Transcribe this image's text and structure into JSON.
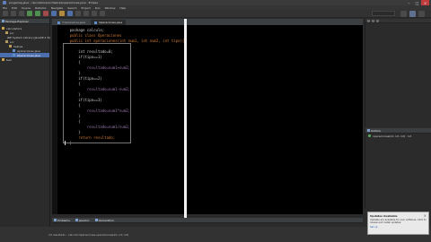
{
  "window": {
    "title": "progamey.java - calculadora/src/hebras/operaciones.java - Eclipse",
    "buttons": {
      "minimize": "–",
      "maximize": "□",
      "close": "✕"
    }
  },
  "menu": [
    "File",
    "Edit",
    "Source",
    "Refactor",
    "Navigate",
    "Search",
    "Project",
    "Run",
    "Window",
    "Help"
  ],
  "left_panel": {
    "tab_label": "Package Explorer",
    "items": [
      {
        "label": "calculadora",
        "icon": "project-icon"
      },
      {
        "label": "src",
        "icon": "package-folder-icon"
      },
      {
        "label": "JRE System Library [JavaSE-1.8]",
        "icon": "library-icon"
      },
      {
        "label": "src",
        "icon": "package-folder-icon"
      },
      {
        "label": "hebras",
        "icon": "package-icon"
      },
      {
        "label": "Aplicaciones.java",
        "icon": "java-file-icon"
      },
      {
        "label": "Operaciones.java",
        "icon": "java-file-icon",
        "selected": true
      },
      {
        "label": "test",
        "icon": "project-icon"
      }
    ]
  },
  "editor": {
    "tabs": [
      {
        "label": "*calculadora.java",
        "active": false
      },
      {
        "label": "Operaciones.java",
        "active": true
      }
    ],
    "code": [
      "    package calculo;",
      "    public class Operaciones",
      "    public int operaciones(int num1, int num2, int tipo){",
      "",
      "        int resultado=0;",
      "        if(tipo==1)",
      "        {",
      "            resultado=num1+num2;",
      "        }",
      "        if(tipo==2)",
      "        {",
      "            resultado=num1-num2;",
      "        }",
      "        if(tipo==3)",
      "        {",
      "            resultado=num1*num2;",
      "        }",
      "        {",
      "            resultado=num1/num2;",
      "        }",
      "        return resultado;",
      "    }"
    ]
  },
  "right_panel": {
    "outline_label": "Outline",
    "outline_items": [
      "operaciones(int, int, int) : int"
    ]
  },
  "console": {
    "tabs": [
      "Problems",
      "Javadoc",
      "Declaration"
    ]
  },
  "status": {
    "text": "int resultado - calculo.Operaciones.operaciones(int, int, int)"
  },
  "notification": {
    "title": "Updates Available",
    "text": "Updates are available for your software. Click to review and install updates.",
    "link": "Set up",
    "close": "×"
  }
}
